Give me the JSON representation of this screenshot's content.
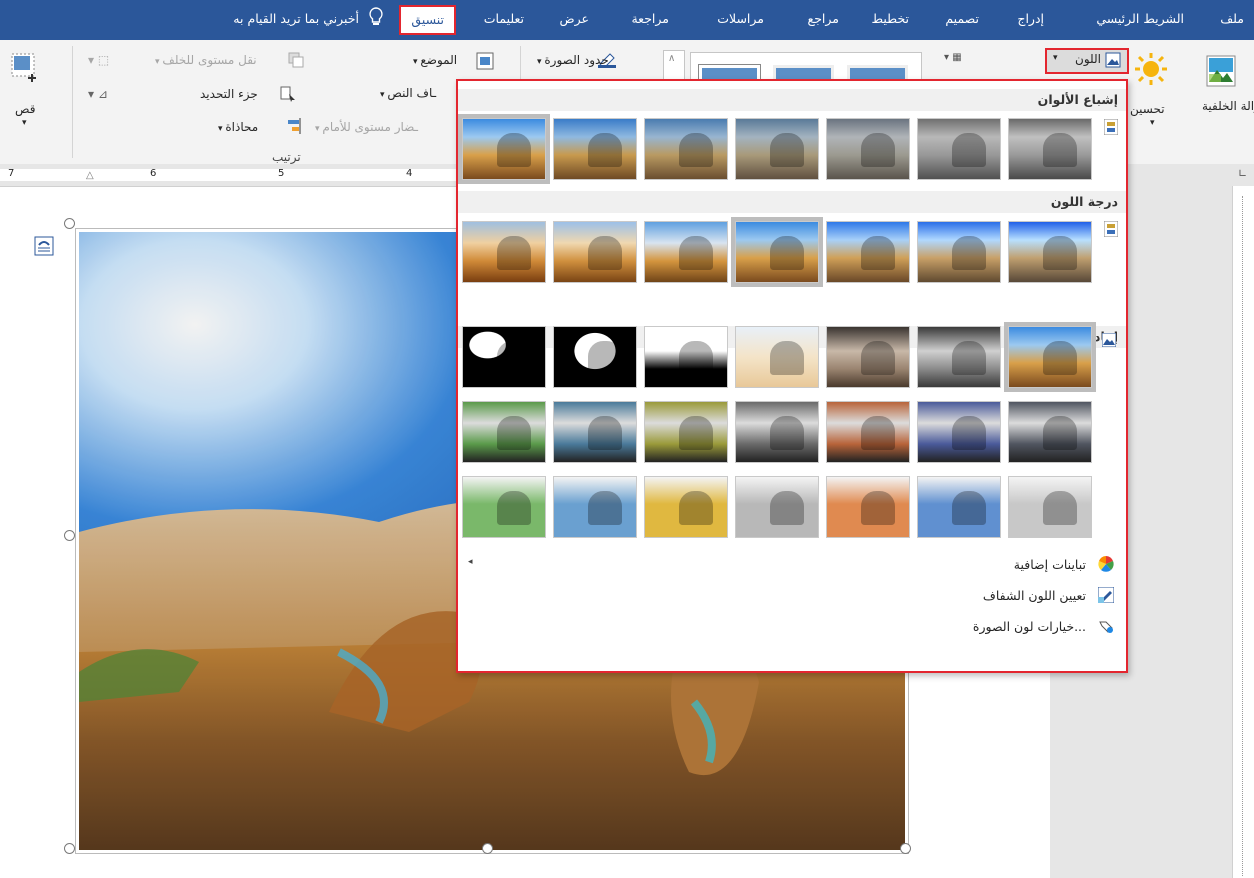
{
  "tabs": [
    {
      "label": "ملف",
      "active": false
    },
    {
      "label": "الشريط الرئيسي",
      "active": false
    },
    {
      "label": "إدراج",
      "active": false
    },
    {
      "label": "تصميم",
      "active": false
    },
    {
      "label": "تخطيط",
      "active": false
    },
    {
      "label": "مراجع",
      "active": false
    },
    {
      "label": "مراسلات",
      "active": false
    },
    {
      "label": "مراجعة",
      "active": false
    },
    {
      "label": "عرض",
      "active": false
    },
    {
      "label": "تعليمات",
      "active": false
    },
    {
      "label": "تنسيق",
      "active": true
    }
  ],
  "tell_me": "أخبرني بما تريد القيام به",
  "ribbon": {
    "remove_background": "إزالة الخلفية",
    "corrections": "تحسين",
    "color": "اللون",
    "picture_border": "حدود الصورة",
    "position": "الموضع",
    "wrap_text": "ـاف النص",
    "bring_forward": "ـضار مستوى للأمام",
    "send_backward": "نقل مستوى للخلف",
    "selection_pane": "جزء التحديد",
    "align": "محاذاة",
    "arrange_group": "ترتيب",
    "crop": "قص"
  },
  "ruler_numbers": [
    "7",
    "6",
    "5",
    "4"
  ],
  "dropdown": {
    "saturation_title": "إشباع الألوان",
    "tone_title": "درجة اللون",
    "recolor_title": "إعادة تلوين",
    "more_variations": "تباينات إضافية",
    "set_transparent": "تعيين اللون الشفاف",
    "picture_color_options": "خيارات لون الصورة..."
  },
  "colors": {
    "tabbar": "#2b579a",
    "highlight": "#e3262f"
  }
}
